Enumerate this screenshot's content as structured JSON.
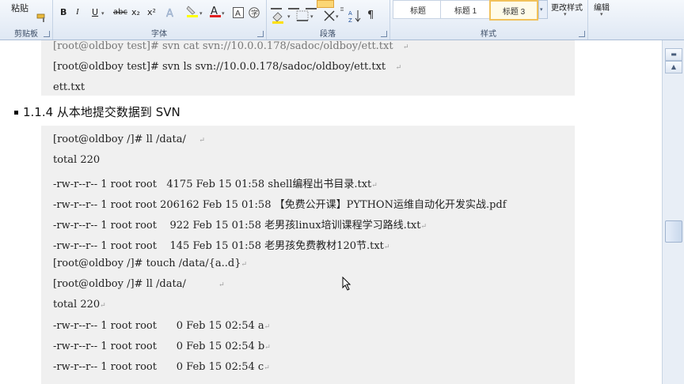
{
  "ribbon": {
    "paste_label": "粘贴",
    "clipboard_label": "剪贴板",
    "font_label": "字体",
    "paragraph_label": "段落",
    "styles_label": "样式",
    "edit_label": "编辑",
    "change_styles_label": "更改样式",
    "styles": [
      "标题",
      "标题 1",
      "标题 3"
    ],
    "buttons": {
      "bold": "B",
      "italic": "I",
      "underline": "U",
      "strike": "abc",
      "subscript": "x₂",
      "superscript": "x²",
      "font_color": "A"
    }
  },
  "doc": {
    "block1": [
      "[root@oldboy test]# svn cat svn://10.0.0.178/sadoc/oldboy/ett.txt",
      "[root@oldboy test]# svn ls svn://10.0.0.178/sadoc/oldboy/ett.txt",
      "ett.txt"
    ],
    "heading": "1.1.4 从本地提交数据到 SVN",
    "block2": [
      "[root@oldboy /]# ll /data/",
      "total 220",
      "-rw-r--r-- 1 root root   4175 Feb 15 01:58 shell编程出书目录.txt",
      "-rw-r--r-- 1 root root 206162 Feb 15 01:58 【免费公开课】PYTHON运维自动化开发实战.pdf",
      "-rw-r--r-- 1 root root    922 Feb 15 01:58 老男孩linux培训课程学习路线.txt",
      "-rw-r--r-- 1 root root    145 Feb 15 01:58 老男孩免费教材120节.txt",
      "[root@oldboy /]# touch /data/{a..d}",
      "[root@oldboy /]# ll /data/",
      "total 220",
      "-rw-r--r-- 1 root root      0 Feb 15 02:54 a",
      "-rw-r--r-- 1 root root      0 Feb 15 02:54 b",
      "-rw-r--r-- 1 root root      0 Feb 15 02:54 c"
    ],
    "para_mark": "↵"
  }
}
